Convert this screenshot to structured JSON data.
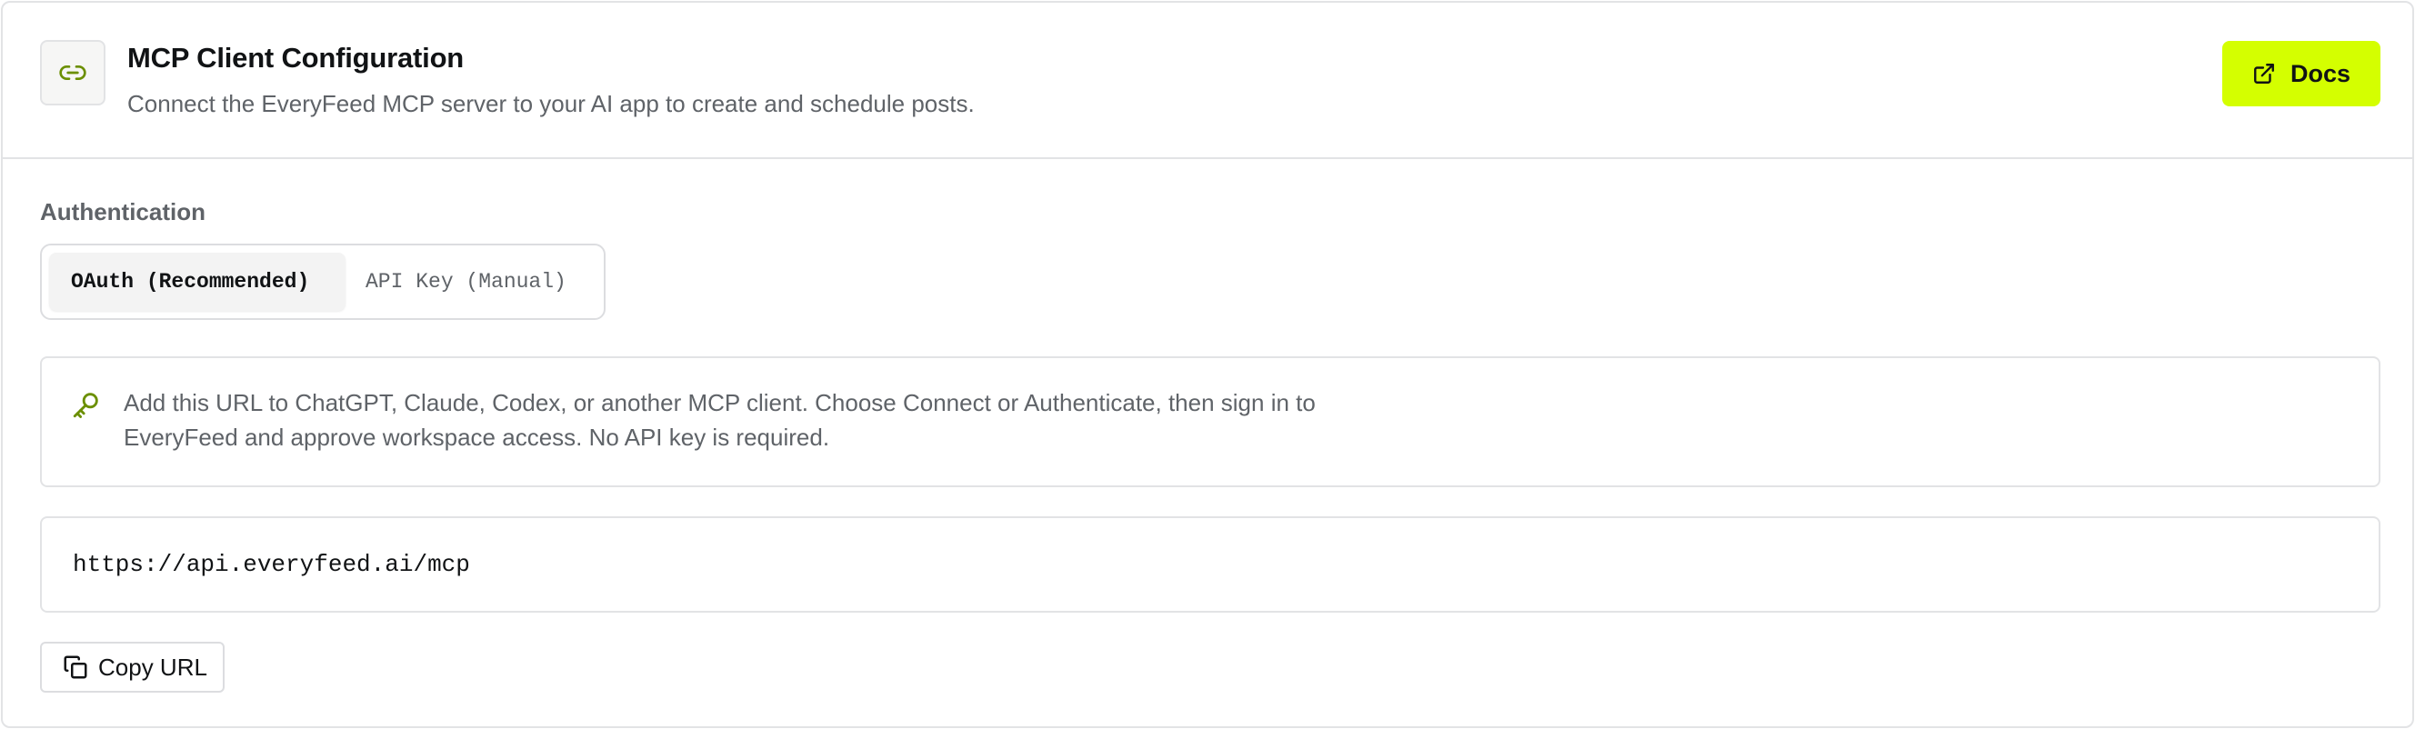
{
  "header": {
    "title": "MCP Client Configuration",
    "subtitle": "Connect the EveryFeed MCP server to your AI app to create and schedule posts.",
    "icon": "link-icon",
    "docs_label": "Docs",
    "docs_icon": "external-link-icon"
  },
  "authentication": {
    "label": "Authentication",
    "tabs": [
      {
        "label": "OAuth (Recommended)",
        "selected": true
      },
      {
        "label": "API Key (Manual)",
        "selected": false
      }
    ]
  },
  "info": {
    "icon": "key-icon",
    "text": "Add this URL to ChatGPT, Claude, Codex, or another MCP client. Choose Connect or Authenticate, then sign in to EveryFeed and approve workspace access. No API key is required."
  },
  "endpoint": {
    "url": "https://api.everyfeed.ai/mcp"
  },
  "copy": {
    "label": "Copy URL",
    "icon": "copy-icon"
  },
  "colors": {
    "accent": "#d4ff00",
    "icon_green": "#6b8f00",
    "border": "#e2e3e5",
    "muted_text": "#5f6368"
  }
}
